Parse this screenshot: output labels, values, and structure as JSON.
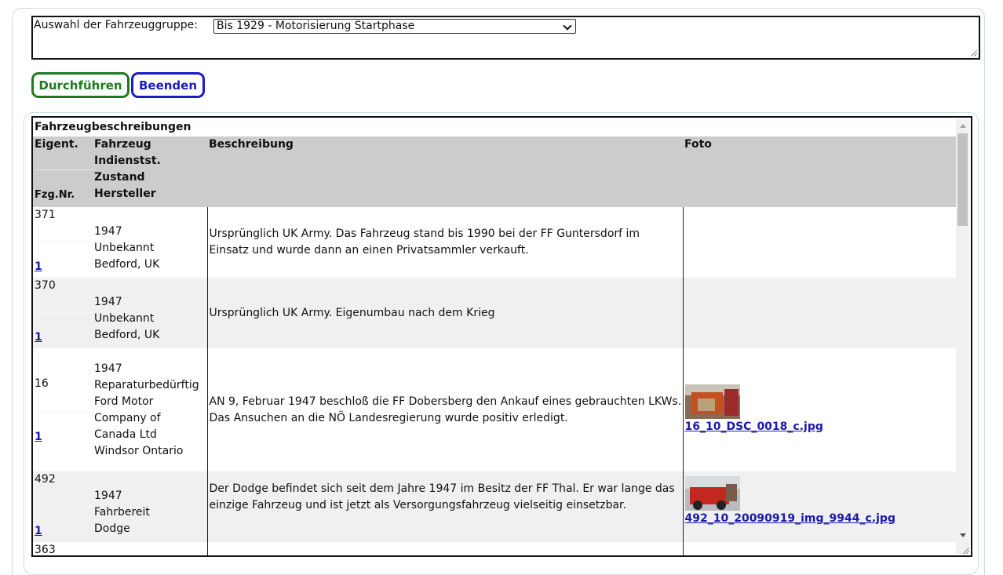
{
  "selector": {
    "label": "Auswahl der Fahrzeuggruppe:",
    "selected": "Bis 1929 - Motorisierung Startphase"
  },
  "buttons": {
    "run_label": "Durchführen",
    "end_label": "Beenden"
  },
  "table": {
    "caption": "Fahrzeugbeschreibungen",
    "headers": {
      "eigent": "Eigent.",
      "fzgnr": "Fzg.Nr.",
      "fahrzeug": "Fahrzeug",
      "indienstst": "Indienstst.",
      "zustand": "Zustand",
      "hersteller": "Hersteller",
      "beschreibung": "Beschreibung",
      "foto": "Foto"
    },
    "rows": [
      {
        "fzgnr": "371",
        "eigent": "1",
        "year": "1947",
        "zustand": "Unbekannt",
        "hersteller": [
          "Bedford, UK"
        ],
        "beschreibung": "Ursprünglich UK Army. Das Fahrzeug stand bis 1990 bei der FF Guntersdorf im Einsatz und wurde dann an einen Privatsammler verkauft.",
        "foto": ""
      },
      {
        "fzgnr": "370",
        "eigent": "1",
        "year": "1947",
        "zustand": "Unbekannt",
        "hersteller": [
          "Bedford, UK"
        ],
        "beschreibung": "Ursprünglich UK Army. Eigenumbau nach dem Krieg",
        "foto": ""
      },
      {
        "fzgnr": "16",
        "eigent": "1",
        "year": "1947",
        "zustand": "Reparaturbedürftig",
        "hersteller": [
          "Ford Motor",
          "Company of",
          "Canada Ltd",
          "Windsor Ontario"
        ],
        "beschreibung": "AN 9, Februar 1947 beschloß die FF Dobersberg den Ankauf eines gebrauchten LKWs. Das Ansuchen an die NÖ Landesregierung wurde positiv erledigt.",
        "foto": "16_10_DSC_0018_c.jpg"
      },
      {
        "fzgnr": "492",
        "eigent": "1",
        "year": "1947",
        "zustand": "Fahrbereit",
        "hersteller": [
          "Dodge"
        ],
        "beschreibung": "Der Dodge befindet sich seit dem Jahre 1947 im Besitz der FF Thal. Er war lange das einzige Fahrzeug und ist jetzt als Versorgungsfahrzeug vielseitig einsetzbar.",
        "foto": "492_10_20090919_img_9944_c.jpg"
      },
      {
        "fzgnr": "363"
      }
    ]
  }
}
